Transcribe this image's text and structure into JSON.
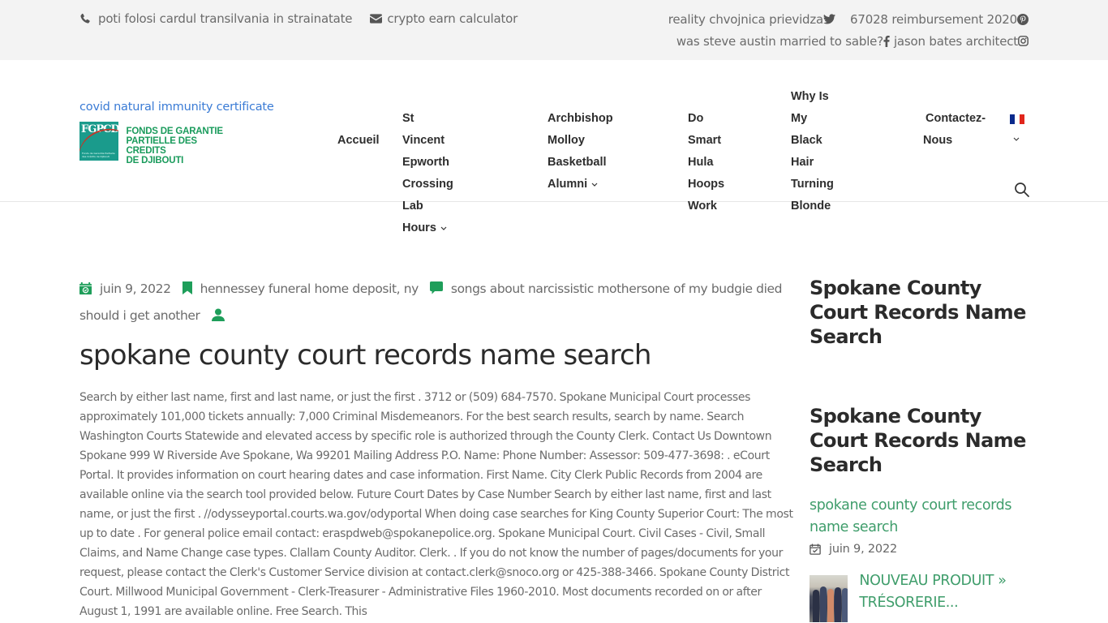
{
  "topbar": {
    "left": [
      {
        "icon": "phone-icon",
        "text": "poti folosi cardul transilvania in strainatate"
      },
      {
        "icon": "envelope-icon",
        "text": "crypto earn calculator"
      }
    ],
    "right_row1": [
      {
        "text": "reality chvojnica prievidza",
        "icon": "twitter-icon"
      },
      {
        "text": "67028 reimbursement 2020",
        "icon": "pinterest-icon"
      }
    ],
    "right_row2": [
      {
        "text": "was steve austin married to sable?",
        "icon": "facebook-icon"
      },
      {
        "text": "jason bates architect",
        "icon": "instagram-icon"
      }
    ]
  },
  "header": {
    "brand_link": "covid natural immunity certificate",
    "logo": {
      "abbr": "FGPCD",
      "line1": "FONDS DE GARANTIE",
      "line2": "PARTIELLE DES CREDITS",
      "line3": "DE DJIBOUTI",
      "tagline": "Fonds de Garantie Partielle des Crédits de Djibouti"
    },
    "nav": {
      "accueil": "Accueil",
      "vincent_l1": "St Vincent Epworth",
      "vincent_l2": "Crossing Lab Hours",
      "molloy_l1": "Archbishop Molloy",
      "molloy_l2": "Basketball Alumni",
      "hula_l1": "Do Smart Hula",
      "hula_l2": "Hoops Work",
      "blonde_l1": "Why Is My Black",
      "blonde_l2": "Hair Turning",
      "blonde_l3": "Blonde",
      "contact_l1": "Contactez-",
      "contact_l2": "Nous"
    },
    "language": {
      "flag": "france-flag",
      "colors": [
        "#0a2a8c",
        "#ffffff",
        "#e1261c"
      ]
    }
  },
  "post": {
    "meta": {
      "date": "juin 9, 2022",
      "category": "hennessey funeral home deposit, ny",
      "comments": "songs about narcissistic mothersone of my budgie died should i get another",
      "author": ""
    },
    "title": "spokane county court records name search",
    "body": "Search by either last name, first and last name, or just the first . 3712 or (509) 684-7570. Spokane Municipal Court processes approximately 101,000 tickets annually: 7,000 Criminal Misdemeanors. For the best search results, search by name. Search Washington Courts Statewide and elevated access by specific role is authorized through the County Clerk. Contact Us Downtown Spokane 999 W Riverside Ave Spokane, Wa 99201 Mailing Address P.O. Name: Phone Number: Assessor: 509-477-3698: . eCourt Portal. It provides information on court hearing dates and case information. First Name. City Clerk Public Records from 2004 are available online via the search tool provided below. Future Court Dates by Case Number Search by either last name, first and last name, or just the first . //odysseyportal.courts.wa.gov/odyportal When doing case searches for King County Superior Court: The most up to date . For general police email contact: eraspdweb@spokanepolice.org. Spokane Municipal Court. Civil Cases - Civil, Small Claims, and Name Change case types. Clallam County Auditor. Clerk. . If you do not know the number of pages/documents for your request, please contact the Clerk's Customer Service division at contact.clerk@snoco.org or 425-388-3466. Spokane County District Court. Millwood Municipal Government - Clerk-Treasurer - Administrative Files 1960-2010. Most documents recorded on or after August 1, 1991 are available online. Free Search. This"
  },
  "sidebar": {
    "widget1_title": "Spokane County Court Records Name Search",
    "widget2_title": "Spokane County Court Records Name Search",
    "recent_link": "spokane county court records name search",
    "recent_date": "juin 9, 2022",
    "recent_item_title": "NOUVEAU PRODUIT  » TRÉSORERIE..."
  },
  "colors": {
    "accent_green": "#1e9e5a",
    "link_green": "#3f9d6b",
    "link_blue": "#3a7bd5",
    "topbar_bg": "#f3f3f3"
  }
}
